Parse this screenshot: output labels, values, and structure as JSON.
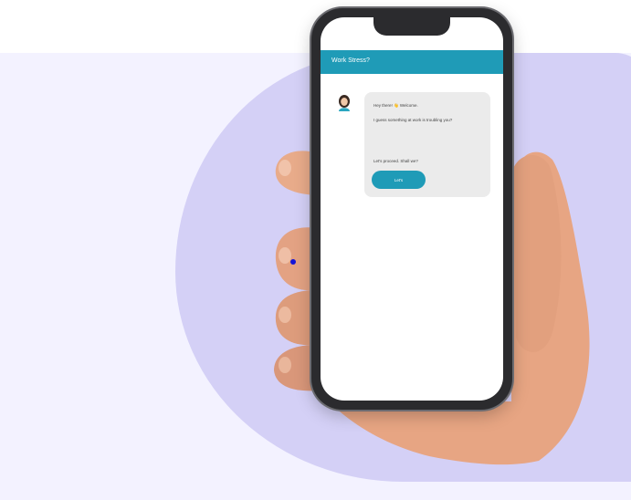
{
  "app": {
    "title": "Work Stress?"
  },
  "chat": {
    "greeting": "Hey there! 👋 Welcome.",
    "message": "I guess something at work is troubling you?",
    "prompt": "Let's proceed. Shall we?",
    "button_label": "Let's"
  },
  "colors": {
    "brand": "#1f9bb7",
    "background_panel": "#f3f2ff",
    "blob": "#d4d0f6",
    "bubble": "#ebebeb",
    "phone_frame": "#2b2b2e",
    "cursor": "#1414d6"
  },
  "icons": {
    "avatar": "woman-avatar-icon"
  }
}
